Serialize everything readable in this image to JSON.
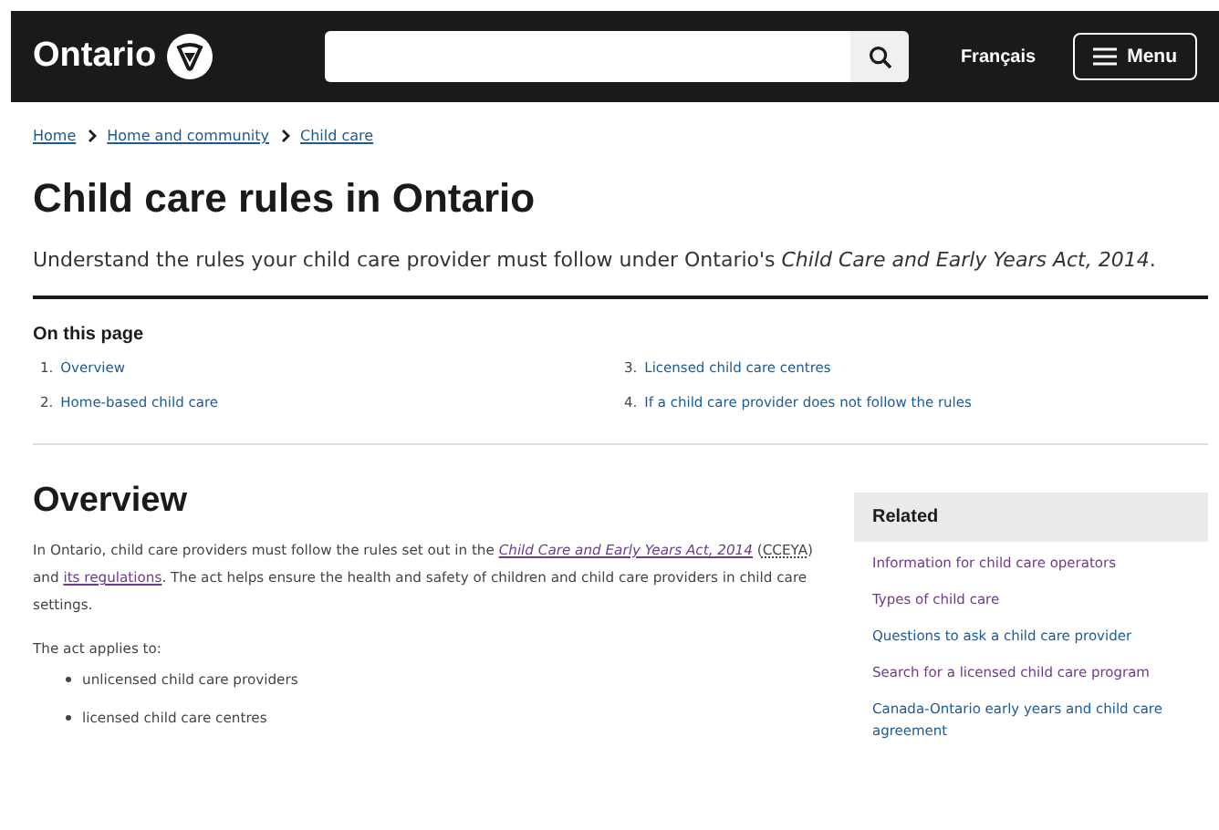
{
  "header": {
    "logo": "Ontario",
    "language": "Français",
    "menu": "Menu"
  },
  "breadcrumbs": [
    {
      "label": "Home"
    },
    {
      "label": "Home and community"
    },
    {
      "label": "Child care"
    }
  ],
  "title": "Child care rules in Ontario",
  "intro": "Understand the rules your child care provider must follow under Ontario's *Child Care and Early Years Act, 2014*.",
  "on_this_page": {
    "heading": "On this page",
    "items": [
      {
        "number": "1.",
        "label": "Overview"
      },
      {
        "number": "2.",
        "label": "Home-based child care"
      },
      {
        "number": "3.",
        "label": "Licensed child care centres"
      },
      {
        "number": "4.",
        "label": "If a child care provider does not follow the rules"
      }
    ]
  },
  "overview": {
    "heading": "Overview",
    "paragraph": [
      {
        "kind": "text",
        "text": "In Ontario, child care providers must follow the rules set out in the "
      },
      {
        "kind": "link",
        "text": "Child Care and Early Years Act, 2014",
        "italic": true,
        "visited": true
      },
      {
        "kind": "text",
        "text": " ("
      },
      {
        "kind": "abbr",
        "text": "CCEYA"
      },
      {
        "kind": "text",
        "text": ") and "
      },
      {
        "kind": "link",
        "text": "its regulations",
        "italic": false,
        "visited": true
      },
      {
        "kind": "text",
        "text": ". The act helps ensure the health and safety of children and child care providers in child care settings."
      }
    ],
    "applies": "The act applies to:",
    "bullets": [
      "unlicensed child care providers",
      "licensed child care centres"
    ]
  },
  "related": {
    "heading": "Related",
    "links": [
      {
        "label": "Information for child care operators",
        "visited": true
      },
      {
        "label": "Types of child care",
        "visited": true
      },
      {
        "label": "Questions to ask a child care provider",
        "visited": false
      },
      {
        "label": "Search for a licensed child care program",
        "visited": true
      },
      {
        "label": "Canada-Ontario early years and child care agreement",
        "visited": false
      }
    ]
  }
}
